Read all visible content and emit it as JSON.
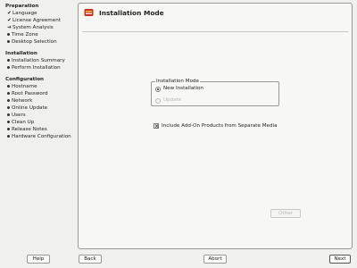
{
  "sidebar": {
    "sections": [
      {
        "title": "Preparation",
        "items": [
          {
            "label": "Language",
            "state": "done"
          },
          {
            "label": "License Agreement",
            "state": "done"
          },
          {
            "label": "System Analysis",
            "state": "current"
          },
          {
            "label": "Time Zone",
            "state": "pending"
          },
          {
            "label": "Desktop Selection",
            "state": "pending"
          }
        ]
      },
      {
        "title": "Installation",
        "items": [
          {
            "label": "Installation Summary",
            "state": "pending"
          },
          {
            "label": "Perform Installation",
            "state": "pending"
          }
        ]
      },
      {
        "title": "Configuration",
        "items": [
          {
            "label": "Hostname",
            "state": "pending"
          },
          {
            "label": "Root Password",
            "state": "pending"
          },
          {
            "label": "Network",
            "state": "pending"
          },
          {
            "label": "Online Update",
            "state": "pending"
          },
          {
            "label": "Users",
            "state": "pending"
          },
          {
            "label": "Clean Up",
            "state": "pending"
          },
          {
            "label": "Release Notes",
            "state": "pending"
          },
          {
            "label": "Hardware Configuration",
            "state": "pending"
          }
        ]
      }
    ]
  },
  "header": {
    "title": "Installation Mode",
    "icon": "installation-mode-icon"
  },
  "group": {
    "legend": "Installation Mode",
    "options": [
      {
        "label": "New Installation",
        "checked": true,
        "enabled": true
      },
      {
        "label": "Update",
        "checked": false,
        "enabled": false
      }
    ]
  },
  "addon": {
    "label": "Include Add-On Products from Separate Media",
    "checked": true,
    "mark": "×"
  },
  "other_button": {
    "label": "Other"
  },
  "buttons": {
    "help": "Help",
    "back": "Back",
    "abort": "Abort",
    "next": "Next"
  },
  "colors": {
    "background": "#f0f0ec",
    "panel": "#f7f7f3",
    "border": "#9a9a94"
  }
}
